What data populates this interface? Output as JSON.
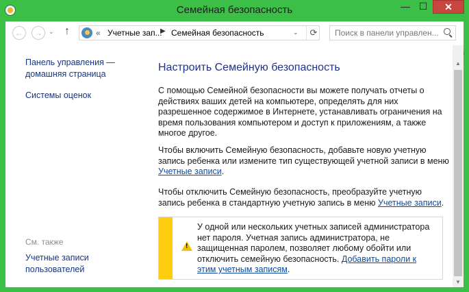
{
  "window": {
    "title": "Семейная безопасность"
  },
  "titlebar": {
    "minimize": "—",
    "maximize": "☐",
    "close": "✕"
  },
  "nav": {
    "back": "←",
    "forward": "→",
    "dropdown": "⌄",
    "up": "↑"
  },
  "address": {
    "chevrons": "«",
    "crumb1": "Учетные зап...",
    "separator": "▶",
    "crumb2": "Семейная безопасность",
    "dropdown": "⌄",
    "refresh": "⟳"
  },
  "search": {
    "placeholder": "Поиск в панели управлен..."
  },
  "help": {
    "label": "?"
  },
  "sidebar": {
    "home": "Панель управления — домашняя страница",
    "ratings": "Системы оценок",
    "see_also": "См. также",
    "accounts": "Учетные записи пользователей"
  },
  "main": {
    "heading": "Настроить Семейную безопасность",
    "p1": "С помощью Семейной безопасности вы можете получать отчеты о действиях ваших детей на компьютере, определять для них разрешенное содержимое в Интернете, устанавливать ограничения на время пользования компьютером и доступ к приложениям, а также многое другое.",
    "p2_text": "Чтобы включить Семейную безопасность, добавьте новую учетную запись ребенка или измените тип существующей учетной записи в меню ",
    "p2_link": "Учетные записи",
    "p2_end": ".",
    "p3_text": "Чтобы отключить Семейную безопасность, преобразуйте учетную запись ребенка в стандартную учетную запись в меню ",
    "p3_link": "Учетные записи",
    "p3_end": ".",
    "warning_text": "У одной или нескольких учетных записей администратора нет пароля. Учетная запись администратора, не защищенная паролем, позволяет любому обойти или отключить семейную безопасность. ",
    "warning_link": "Добавить пароли к этим учетным записям",
    "warning_end": "."
  },
  "scrollbar": {
    "up": "▲",
    "down": "▼"
  },
  "colors": {
    "frame": "#3cbf46",
    "close": "#c7463f",
    "link": "#0b4a9f",
    "heading": "#1e3287",
    "warning_bar": "#ffcd10"
  }
}
